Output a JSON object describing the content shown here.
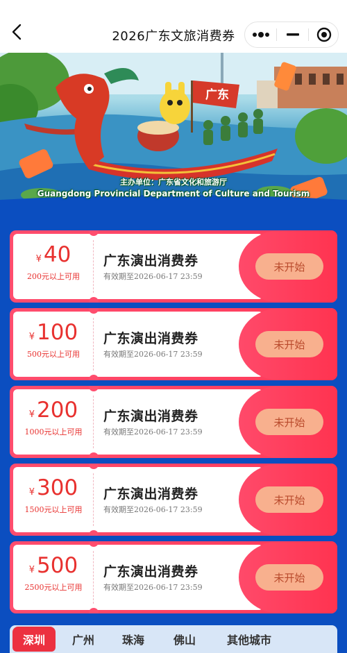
{
  "navbar": {
    "title": "2026广东文旅消费券"
  },
  "banner": {
    "flag_text": "广东",
    "organizer_cn": "主办单位：广东省文化和旅游厅",
    "organizer_en": "Guangdong Provincial Department of Culture and Tourism"
  },
  "coupons": [
    {
      "currency": "¥",
      "amount": "40",
      "condition": "200元以上可用",
      "name": "广东演出消费券",
      "validity": "有效期至2026-06-17 23:59",
      "status": "未开始"
    },
    {
      "currency": "¥",
      "amount": "100",
      "condition": "500元以上可用",
      "name": "广东演出消费券",
      "validity": "有效期至2026-06-17 23:59",
      "status": "未开始"
    },
    {
      "currency": "¥",
      "amount": "200",
      "condition": "1000元以上可用",
      "name": "广东演出消费券",
      "validity": "有效期至2026-06-17 23:59",
      "status": "未开始"
    },
    {
      "currency": "¥",
      "amount": "300",
      "condition": "1500元以上可用",
      "name": "广东演出消费券",
      "validity": "有效期至2026-06-17 23:59",
      "status": "未开始"
    },
    {
      "currency": "¥",
      "amount": "500",
      "condition": "2500元以上可用",
      "name": "广东演出消费券",
      "validity": "有效期至2026-06-17 23:59",
      "status": "未开始"
    }
  ],
  "city_tabs": [
    {
      "label": "深圳",
      "active": true
    },
    {
      "label": "广州",
      "active": false
    },
    {
      "label": "珠海",
      "active": false
    },
    {
      "label": "佛山",
      "active": false
    },
    {
      "label": "其他城市",
      "active": false
    }
  ],
  "colors": {
    "page_bg": "#0b4ec0",
    "coupon_red": "#ff4d6e",
    "amount_red": "#e8312f",
    "status_btn_bg": "#f8b08e",
    "status_btn_text": "#b94a2c",
    "tab_active": "#ec3140",
    "tab_bar_bg": "#d8e6f7"
  }
}
